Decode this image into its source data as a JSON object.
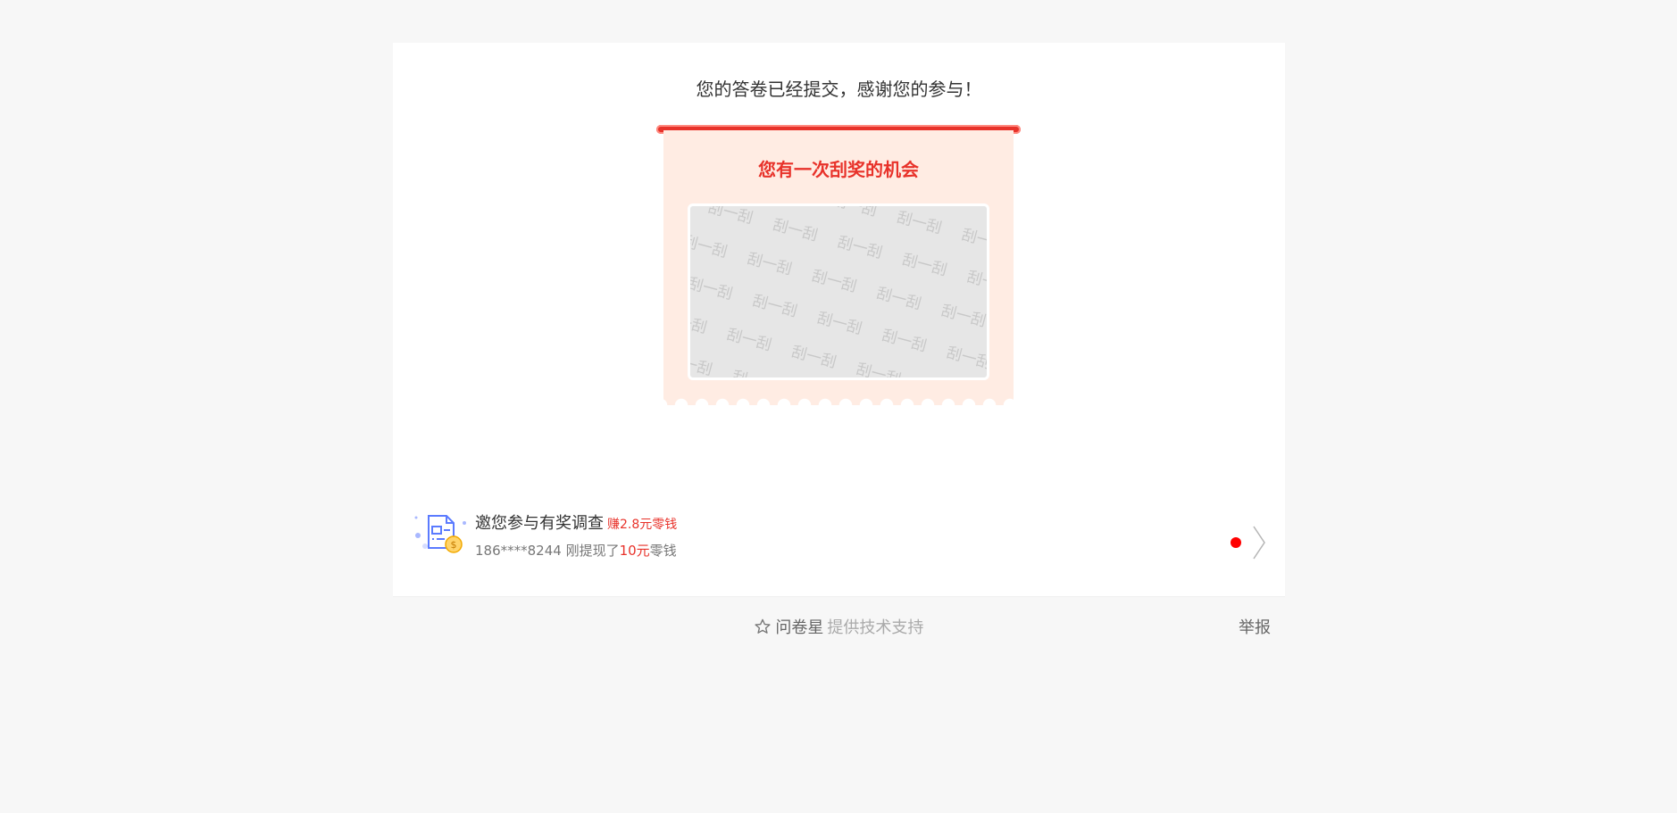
{
  "page": {
    "submitted_message": "您的答卷已经提交，感谢您的参与！"
  },
  "scratch_card": {
    "title": "您有一次刮奖的机会",
    "overlay_text": "刮一刮"
  },
  "invite": {
    "title": "邀您参与有奖调查",
    "earn_text": "赚2.8元零钱",
    "sub_prefix": "186****8244 刚提现了",
    "sub_amount": "10元",
    "sub_suffix": "零钱"
  },
  "footer": {
    "brand": "问卷星",
    "support": "提供技术支持",
    "report": "举报"
  },
  "colors": {
    "accent_red": "#e8322a",
    "ticket_bg": "#ffece3",
    "page_bg": "#f7f7f7"
  },
  "icons": {
    "invite": "survey-money-icon",
    "brand": "star-icon",
    "arrow": "chevron-right-icon"
  }
}
